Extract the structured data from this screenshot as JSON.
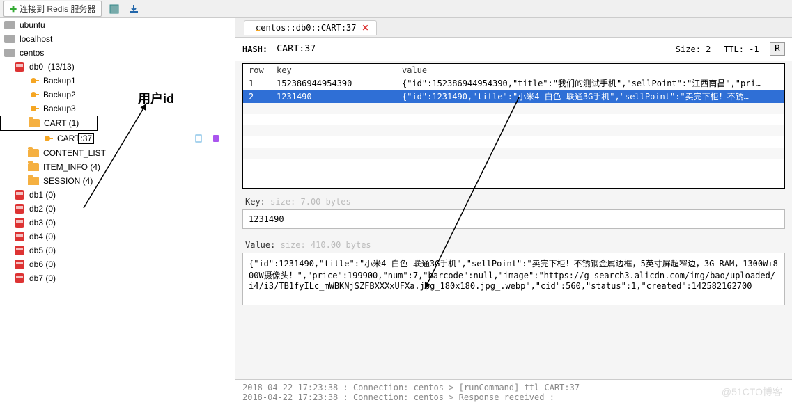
{
  "toolbar": {
    "connect_label": "连接到 Redis 服务器"
  },
  "tree": {
    "servers": [
      {
        "name": "ubuntu"
      },
      {
        "name": "localhost"
      },
      {
        "name": "centos"
      }
    ],
    "dbs": [
      {
        "name": "db0",
        "count": "(13/13)"
      }
    ],
    "keys0": [
      {
        "name": "Backup1",
        "type": "key"
      },
      {
        "name": "Backup2",
        "type": "key"
      },
      {
        "name": "Backup3",
        "type": "key"
      },
      {
        "name": "CART (1)",
        "type": "folder",
        "boxed": true
      },
      {
        "name": "CART",
        "suffix": ":37",
        "type": "key",
        "boxed_child": true,
        "selected": true
      },
      {
        "name": "CONTENT_LIST",
        "type": "folder"
      },
      {
        "name": "ITEM_INFO (4)",
        "type": "folder"
      },
      {
        "name": "SESSION (4)",
        "type": "folder"
      }
    ],
    "other_dbs": [
      {
        "name": "db1",
        "count": "(0)"
      },
      {
        "name": "db2",
        "count": "(0)"
      },
      {
        "name": "db3",
        "count": "(0)"
      },
      {
        "name": "db4",
        "count": "(0)"
      },
      {
        "name": "db5",
        "count": "(0)"
      },
      {
        "name": "db6",
        "count": "(0)"
      },
      {
        "name": "db7",
        "count": "(0)"
      }
    ]
  },
  "tab": {
    "title": "centos::db0::CART:37"
  },
  "hash": {
    "label": "HASH:",
    "value": "CART:37",
    "size_label": "Size: 2",
    "ttl_label": "TTL: -1",
    "r_button": "R"
  },
  "table": {
    "headers": {
      "row": "row",
      "key": "key",
      "value": "value"
    },
    "rows": [
      {
        "row": "1",
        "key": "152386944954390",
        "value": "{\"id\":152386944954390,\"title\":\"我们的测试手机\",\"sellPoint\":\"江西南昌\",\"pri…"
      },
      {
        "row": "2",
        "key": "1231490",
        "value": "{\"id\":1231490,\"title\":\"小米4 白色 联通3G手机\",\"sellPoint\":\"卖完下柜！不锈…",
        "selected": true
      }
    ]
  },
  "key_section": {
    "label": "Key:",
    "hint": "size: 7.00 bytes",
    "value": "1231490"
  },
  "value_section": {
    "label": "Value:",
    "hint": "size: 410.00 bytes",
    "value": "{\"id\":1231490,\"title\":\"小米4 白色 联通3G手机\",\"sellPoint\":\"卖完下柜！不锈钢金属边框，5英寸屏超窄边，3G RAM，1300W+800W摄像头！\",\"price\":199900,\"num\":7,\"barcode\":null,\"image\":\"https://g-search3.alicdn.com/img/bao/uploaded/i4/i3/TB1fyILc_mWBKNjSZFBXXXxUFXa.jpg_180x180.jpg_.webp\",\"cid\":560,\"status\":1,\"created\":142582162700"
  },
  "log": {
    "lines": [
      "2018-04-22 17:23:38 : Connection: centos > [runCommand] ttl CART:37",
      "2018-04-22 17:23:38 : Connection: centos > Response received :"
    ]
  },
  "annotation": {
    "label": "用户id"
  },
  "watermark": "@51CTO博客"
}
